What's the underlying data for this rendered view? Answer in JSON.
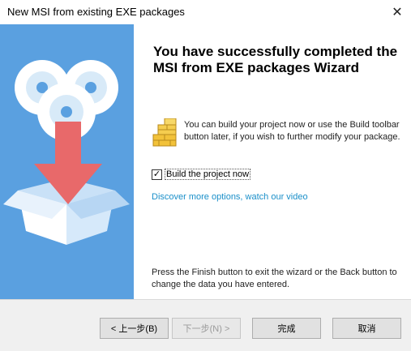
{
  "window": {
    "title": "New MSI from existing EXE packages",
    "close_glyph": "✕"
  },
  "content": {
    "heading": "You have successfully completed the MSI from EXE packages Wizard",
    "info_text": "You can build your project now or use the Build toolbar button later, if you wish to further modify your package.",
    "build_checkbox": {
      "label": "Build the project now",
      "checked": true,
      "check_glyph": "✓"
    },
    "link_text": "Discover more options, watch our video",
    "footer_text": "Press the Finish button to exit the wizard or the Back button to change the data you have entered."
  },
  "buttons": {
    "back": "< 上一步(B)",
    "next": "下一步(N) >",
    "finish": "完成",
    "cancel": "取消"
  },
  "colors": {
    "banner_bg": "#5aa0e0",
    "link": "#1a8fc9",
    "arrow": "#e8696a"
  }
}
